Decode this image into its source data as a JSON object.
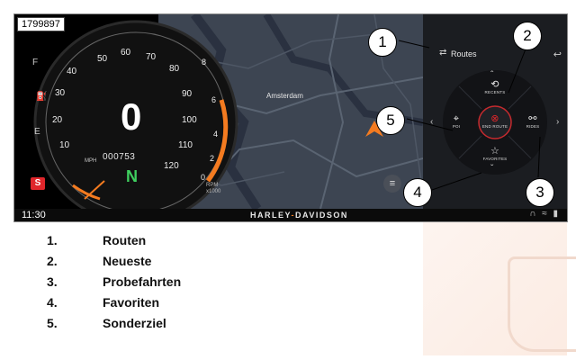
{
  "figure_id": "1799897",
  "gauge": {
    "speed": "0",
    "speed_unit": "MPH",
    "odometer": "000753",
    "gear": "N",
    "rpm_label_line1": "RPM",
    "rpm_label_line2": "x1000",
    "fuel_full": "F",
    "fuel_empty": "E",
    "speed_ticks": [
      "10",
      "20",
      "30",
      "40",
      "50",
      "60",
      "70",
      "80",
      "90",
      "100",
      "110",
      "120"
    ],
    "rpm_ticks": [
      "8",
      "6",
      "4",
      "2",
      "0"
    ]
  },
  "map": {
    "city_label": "Amsterdam"
  },
  "panel": {
    "title": "Routes",
    "buttons": {
      "recents": "RECENTS",
      "poi": "POI",
      "end_route": "END ROUTE",
      "rides": "RIDES",
      "favorites": "FAVORITES"
    }
  },
  "status": {
    "time": "11:30",
    "brand_left": "HARLEY",
    "brand_sep": "-",
    "brand_right": "DAVIDSON"
  },
  "callouts": [
    "1",
    "2",
    "3",
    "4",
    "5"
  ],
  "legend": [
    {
      "num": "1.",
      "label": "Routen"
    },
    {
      "num": "2.",
      "label": "Neueste"
    },
    {
      "num": "3.",
      "label": "Probefahrten"
    },
    {
      "num": "4.",
      "label": "Favoriten"
    },
    {
      "num": "5.",
      "label": "Sonderziel"
    }
  ],
  "colors": {
    "accent_orange": "#f47b20",
    "end_route_red": "#e0262b",
    "gear_green": "#3fd05f"
  }
}
